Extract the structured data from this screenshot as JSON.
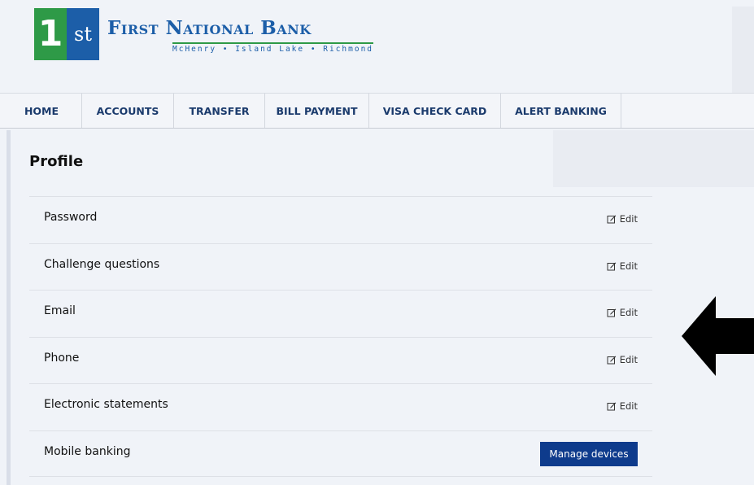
{
  "brand": {
    "logo_number": "1",
    "logo_suffix": "st",
    "name": "First National Bank",
    "tagline": "McHenry • Island Lake • Richmond",
    "colors": {
      "green": "#2e9a47",
      "blue": "#1c5ea8",
      "navy": "#0e3b8c"
    }
  },
  "nav": {
    "items": [
      {
        "label": "HOME"
      },
      {
        "label": "ACCOUNTS"
      },
      {
        "label": "TRANSFER"
      },
      {
        "label": "BILL PAYMENT"
      },
      {
        "label": "VISA CHECK CARD"
      },
      {
        "label": "ALERT BANKING"
      }
    ]
  },
  "page": {
    "title": "Profile"
  },
  "profile": {
    "edit_label": "Edit",
    "edit_icon": "edit-icon",
    "rows": [
      {
        "label": "Password"
      },
      {
        "label": "Challenge questions"
      },
      {
        "label": "Email"
      },
      {
        "label": "Phone"
      },
      {
        "label": "Electronic statements"
      },
      {
        "label": "Mobile banking",
        "button_label": "Manage devices"
      }
    ]
  },
  "annotation": {
    "icon": "left-arrow-icon",
    "color": "#000000"
  }
}
